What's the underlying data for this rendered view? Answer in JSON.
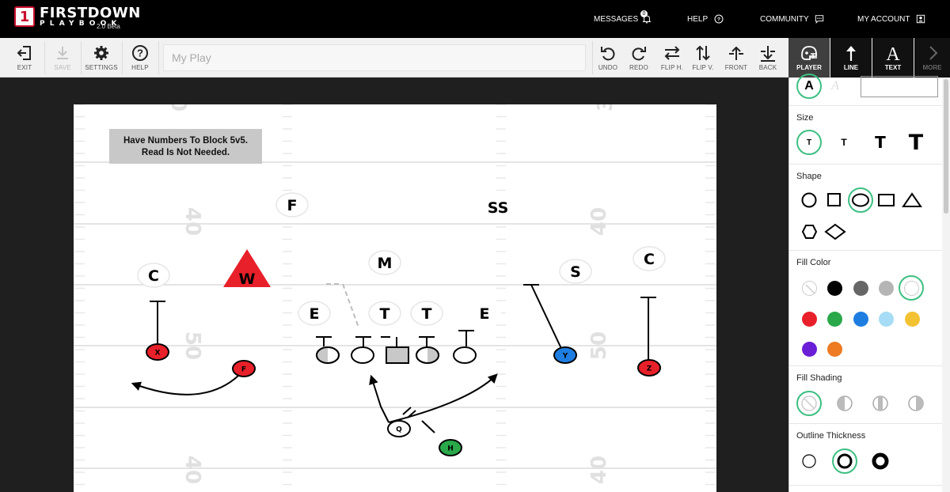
{
  "brand": {
    "name": "FIRSTDOWN",
    "sub": "PLAYBOOK",
    "version": "2.0 Beta",
    "badge": "1"
  },
  "topnav": {
    "messages": "MESSAGES",
    "messages_count": "0",
    "help": "HELP",
    "community": "COMMUNITY",
    "account": "MY ACCOUNT"
  },
  "toolbar": {
    "exit": "EXIT",
    "save": "SAVE",
    "settings": "SETTINGS",
    "help": "HELP",
    "play_name_placeholder": "My Play",
    "undo": "UNDO",
    "redo": "REDO",
    "flip_h": "FLIP H.",
    "flip_v": "FLIP V.",
    "front": "FRONT",
    "back": "BACK"
  },
  "modes": {
    "player": "PLAYER",
    "line": "LINE",
    "text": "TEXT",
    "more": "MORE"
  },
  "field": {
    "note_line1": "Have Numbers To Block 5v5.",
    "note_line2": "Read Is Not Needed.",
    "yard_numbers": [
      "0",
      "3",
      "40",
      "40",
      "50",
      "50",
      "40",
      "40"
    ],
    "defense": [
      {
        "label": "F"
      },
      {
        "label": "SS"
      },
      {
        "label": "M"
      },
      {
        "label": "C"
      },
      {
        "label": "S"
      },
      {
        "label": "C"
      },
      {
        "label": "W"
      },
      {
        "label": "E"
      },
      {
        "label": "T"
      },
      {
        "label": "T"
      },
      {
        "label": "E"
      }
    ],
    "offense": [
      {
        "label": "X",
        "color": "#e8202a"
      },
      {
        "label": "F",
        "color": "#e8202a"
      },
      {
        "label": "Y",
        "color": "#1e7de0"
      },
      {
        "label": "Z",
        "color": "#e8202a"
      },
      {
        "label": "Q",
        "color": "#ffffff"
      },
      {
        "label": "H",
        "color": "#2aa84a"
      }
    ]
  },
  "panel": {
    "text_style": {
      "bold_label": "A",
      "light_label": "A"
    },
    "size": {
      "title": "Size",
      "options": [
        "T",
        "T",
        "T",
        "T"
      ]
    },
    "shape": {
      "title": "Shape"
    },
    "fill_color": {
      "title": "Fill Color",
      "colors": [
        "#000000",
        "#666666",
        "#b5b5b5",
        "#e8202a",
        "#2aa84a",
        "#1e7de0",
        "#a6dcf5",
        "#f3c233",
        "#6a1fd6",
        "#ee7a22"
      ]
    },
    "fill_shading": {
      "title": "Fill Shading"
    },
    "outline": {
      "title": "Outline Thickness"
    }
  },
  "colors": {
    "accent": "#3dbf82",
    "topbar": "#000000",
    "toolbar_active": "#3f3f3f"
  }
}
